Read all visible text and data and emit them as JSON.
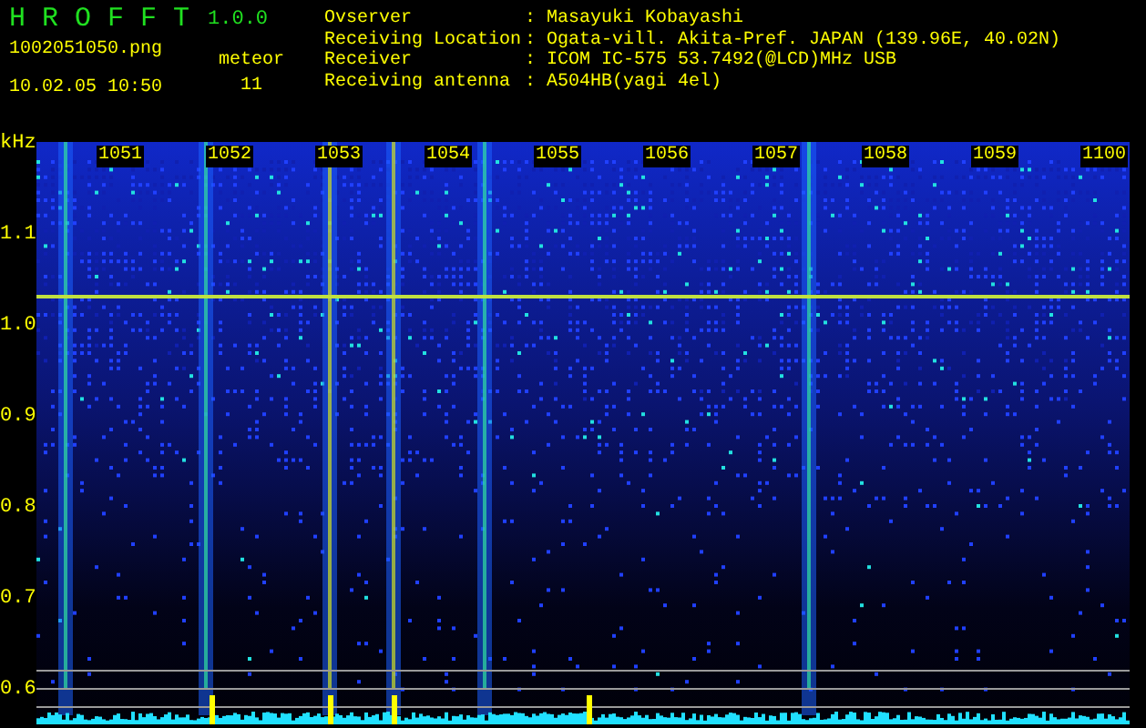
{
  "app": {
    "title": "H R O F F T",
    "version": "1.0.0",
    "file": "1002051050.png",
    "datetime": "10.02.05 10:50",
    "counter_label": "meteor",
    "counter_value": "11"
  },
  "info": [
    {
      "label": "Ovserver",
      "separator": ":",
      "value": "Masayuki Kobayashi"
    },
    {
      "label": "Receiving Location",
      "separator": ":",
      "value": "Ogata-vill. Akita-Pref. JAPAN (139.96E, 40.02N)"
    },
    {
      "label": "Receiver",
      "separator": ":",
      "value": "ICOM IC-575 53.7492(@LCD)MHz USB"
    },
    {
      "label": "Receiving antenna",
      "separator": ":",
      "value": "A504HB(yagi 4el)"
    }
  ],
  "spectrogram": {
    "unit": "kHz",
    "time_labels": [
      "1051",
      "1052",
      "1053",
      "1054",
      "1055",
      "1056",
      "1057",
      "1058",
      "1059",
      "1100"
    ],
    "freq_labels": [
      "1.1",
      "1.0",
      "0.9",
      "0.8",
      "0.7",
      "0.6"
    ]
  }
}
